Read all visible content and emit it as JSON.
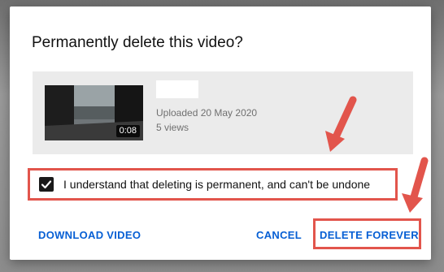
{
  "dialog": {
    "title": "Permanently delete this video?",
    "video": {
      "duration": "0:08",
      "uploaded": "Uploaded 20 May 2020",
      "views": "5 views"
    },
    "confirm_label": "I understand that deleting is permanent, and can't be undone",
    "confirm_checked": true,
    "buttons": {
      "download": "DOWNLOAD VIDEO",
      "cancel": "CANCEL",
      "delete": "DELETE FOREVER"
    }
  },
  "colors": {
    "accent": "#065fd4",
    "annotation": "#e2554c",
    "card_background": "#ebebeb"
  },
  "icons": {
    "checkbox": "checkmark-icon",
    "annotation": "red-arrow-icon"
  }
}
